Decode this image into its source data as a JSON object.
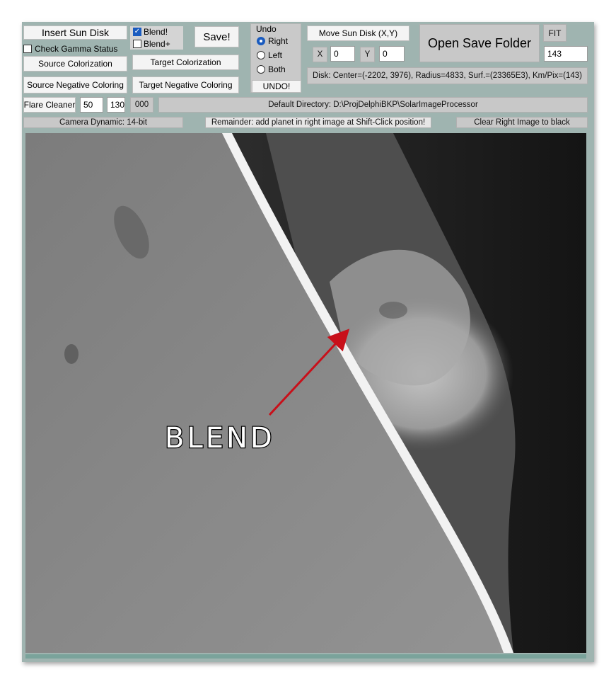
{
  "toolbar": {
    "insert_sun_disk": "Insert Sun Disk",
    "blend_label": "Blend!",
    "blend_checked": true,
    "blend_plus_label": "Blend+",
    "blend_plus_checked": false,
    "save_label": "Save!",
    "check_gamma_label": "Check Gamma Status",
    "check_gamma_checked": false,
    "source_colorization": "Source Colorization",
    "target_colorization": "Target Colorization",
    "source_negative": "Source Negative Coloring",
    "target_negative": "Target Negative Coloring",
    "undo_title": "Undo",
    "undo_options": [
      "Right",
      "Left",
      "Both"
    ],
    "undo_selected": "Right",
    "undo_button": "UNDO!",
    "move_sun_disk": "Move Sun Disk (X,Y)",
    "x_label": "X",
    "x_value": "0",
    "y_label": "Y",
    "y_value": "0",
    "open_save_folder": "Open Save Folder",
    "fit_label": "FIT",
    "fit_value": "143",
    "disk_info": "Disk: Center=(-2202, 3976), Radius=4833, Surf.=(23365E3), Km/Pix=(143)",
    "flare_cleaner": "Flare Cleaner",
    "flare_value_1": "50",
    "flare_value_2": "130",
    "flare_code": "000",
    "default_directory": "Default Directory: D:\\ProjDelphiBKP\\SolarImageProcessor",
    "camera_dynamic": "Camera Dynamic: 14-bit",
    "reminder": "Remainder: add planet in right image at Shift-Click position!",
    "clear_right_image": "Clear Right Image to black"
  },
  "image": {
    "annotation_text": "BLEND",
    "arrow_color": "#c8101a"
  }
}
